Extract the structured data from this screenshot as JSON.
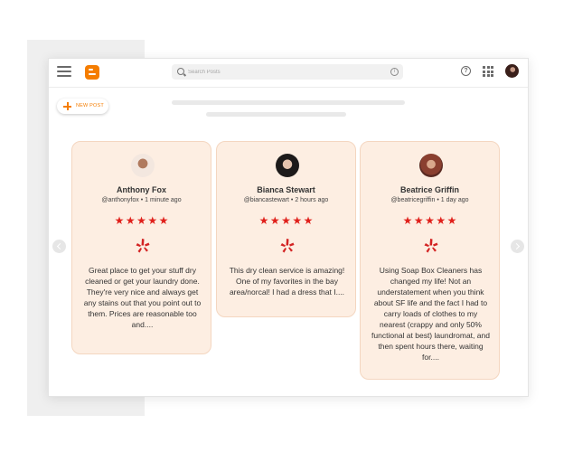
{
  "search": {
    "placeholder": "Search Posts"
  },
  "toolbar": {
    "new_post_label": "NEW POST"
  },
  "reviews": [
    {
      "name": "Anthony Fox",
      "handle": "@anthonyfox",
      "time": "1 minute ago",
      "rating": 5,
      "text": "Great place to get your stuff dry cleaned or get your laundry done. They're very nice and always get any stains out that you point out to them. Prices are reasonable too and...."
    },
    {
      "name": "Bianca Stewart",
      "handle": "@biancastewart",
      "time": "2 hours ago",
      "rating": 5,
      "text": "This dry clean service is amazing! One of my favorites in the bay area/norcal! I had a dress that I...."
    },
    {
      "name": "Beatrice Griffin",
      "handle": "@beatricegriffin",
      "time": "1 day ago",
      "rating": 5,
      "text": "Using Soap Box Cleaners has changed my life! Not an understatement when you think about SF life and the fact I had to carry loads of clothes to my nearest (crappy and only 50% functional at best) laundromat, and then spent hours there, waiting for...."
    }
  ],
  "icons": {
    "menu": "hamburger-menu-icon",
    "logo": "blogger-logo",
    "search": "search-icon",
    "info": "info-icon",
    "help": "help-icon",
    "apps": "apps-grid-icon",
    "review_source": "yelp-icon",
    "star": "star-icon",
    "prev": "chevron-left-icon",
    "next": "chevron-right-icon"
  },
  "colors": {
    "accent": "#f57d00",
    "card_background": "#fdeee2",
    "card_border": "#f4d6c0",
    "star": "#e0201b",
    "yelp": "#d32323"
  }
}
